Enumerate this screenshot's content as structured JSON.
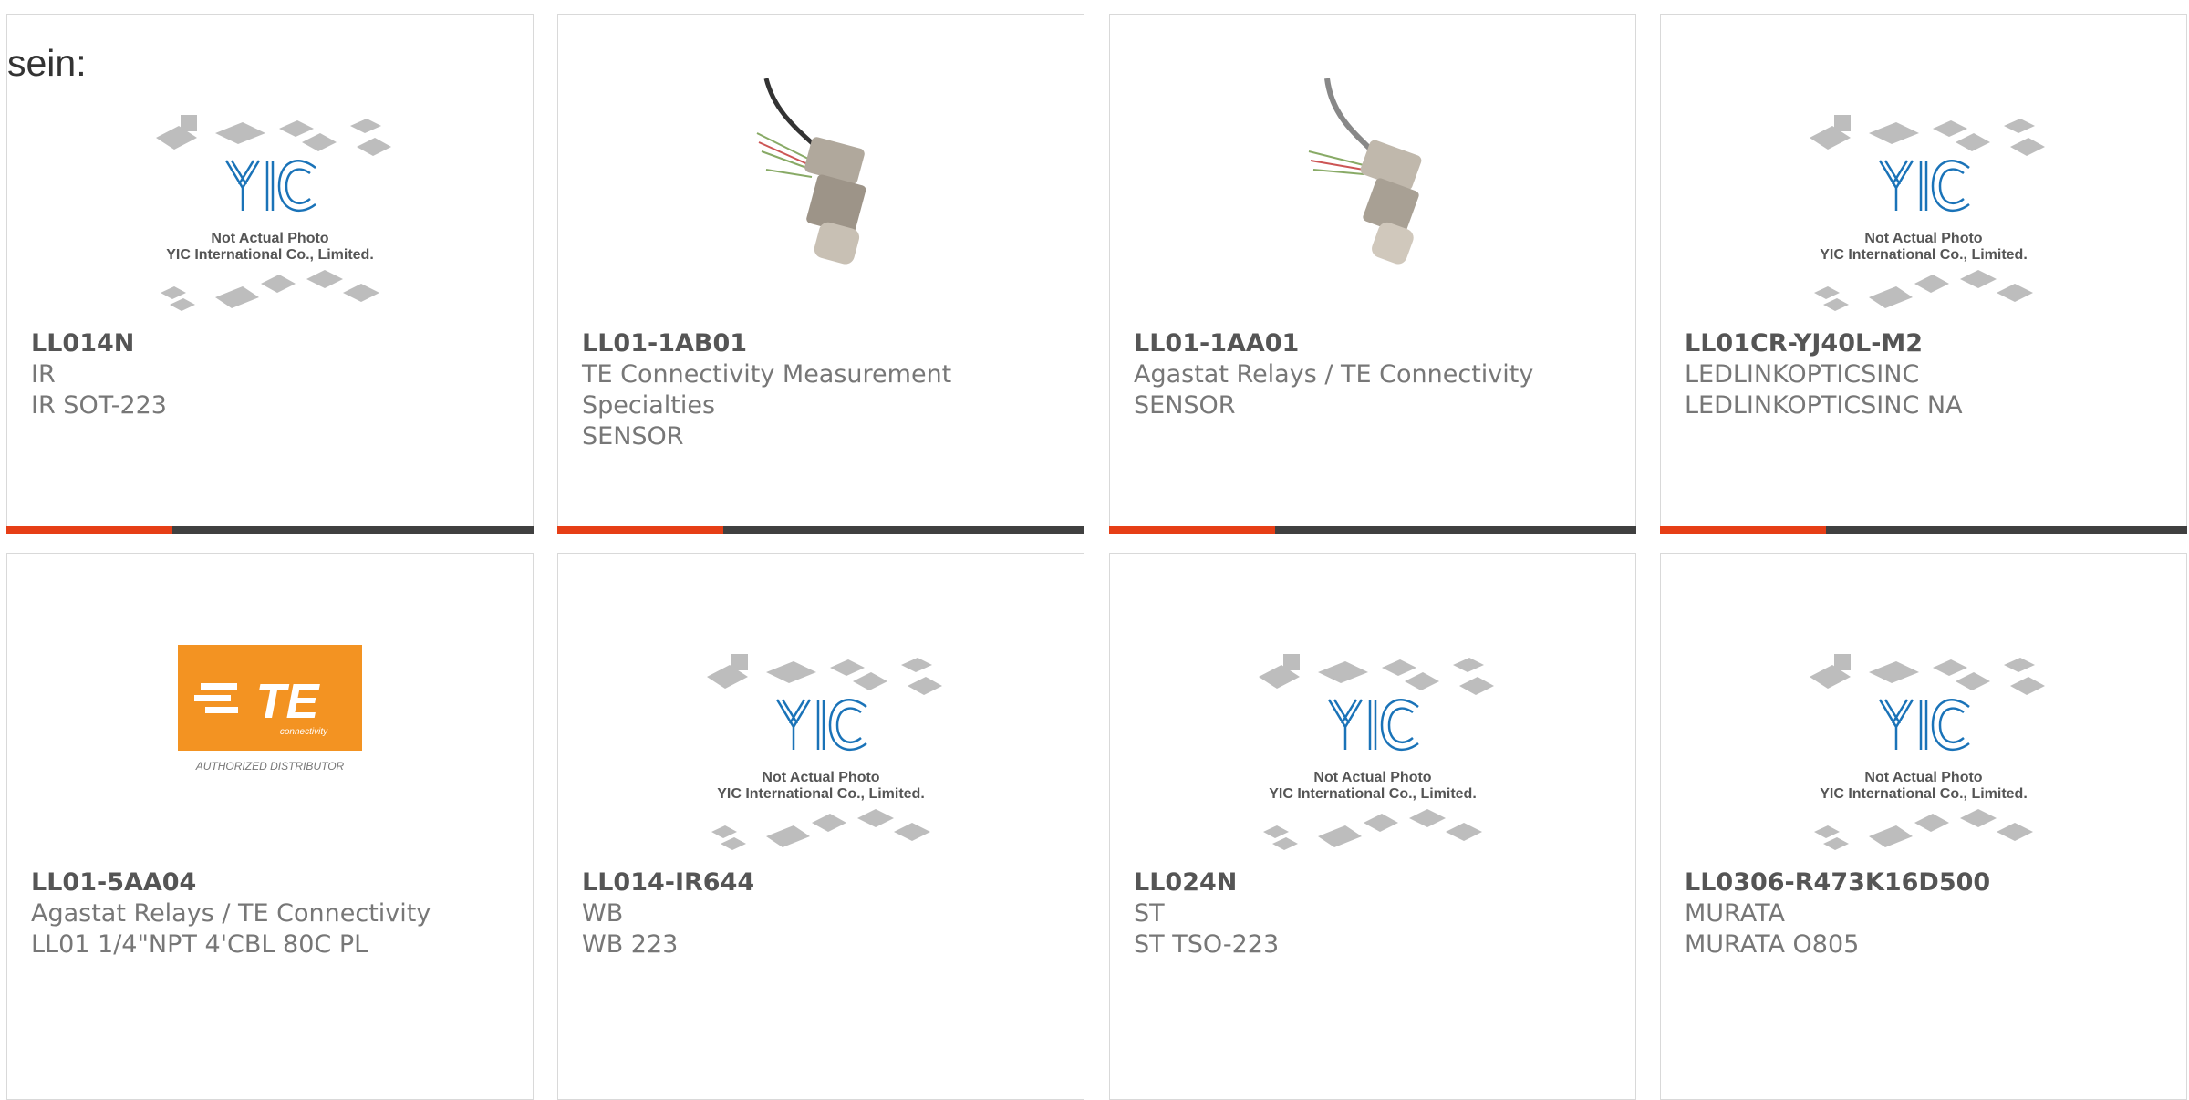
{
  "intro": "sein:",
  "placeholder_line1": "Not Actual Photo",
  "placeholder_line2": "YIC International Co., Limited.",
  "te_caption": "AUTHORIZED DISTRIBUTOR",
  "te_logo_letters": "TE",
  "te_logo_sub": "connectivity",
  "colors": {
    "accent": "#e63e16",
    "bar": "#404040",
    "te_orange": "#f39322",
    "yic_blue": "#1a73b8"
  },
  "products": [
    {
      "part": "LL014N",
      "maker": "IR",
      "desc": "IR SOT-223",
      "image": "yic-placeholder"
    },
    {
      "part": "LL01-1AB01",
      "maker": "TE Connectivity Measurement Specialties",
      "desc": "SENSOR",
      "image": "sensor-photo"
    },
    {
      "part": "LL01-1AA01",
      "maker": "Agastat Relays / TE Connectivity",
      "desc": "SENSOR",
      "image": "sensor-photo"
    },
    {
      "part": "LL01CR-YJ40L-M2",
      "maker": "LEDLINKOPTICSINC",
      "desc": "LEDLINKOPTICSINC NA",
      "image": "yic-placeholder"
    },
    {
      "part": "LL01-5AA04",
      "maker": "Agastat Relays / TE Connectivity",
      "desc": "LL01 1/4\"NPT 4'CBL 80C PL",
      "image": "te-logo"
    },
    {
      "part": "LL014-IR644",
      "maker": "WB",
      "desc": "WB 223",
      "image": "yic-placeholder"
    },
    {
      "part": "LL024N",
      "maker": "ST",
      "desc": "ST TSO-223",
      "image": "yic-placeholder"
    },
    {
      "part": "LL0306-R473K16D500",
      "maker": "MURATA",
      "desc": "MURATA O805",
      "image": "yic-placeholder"
    }
  ]
}
